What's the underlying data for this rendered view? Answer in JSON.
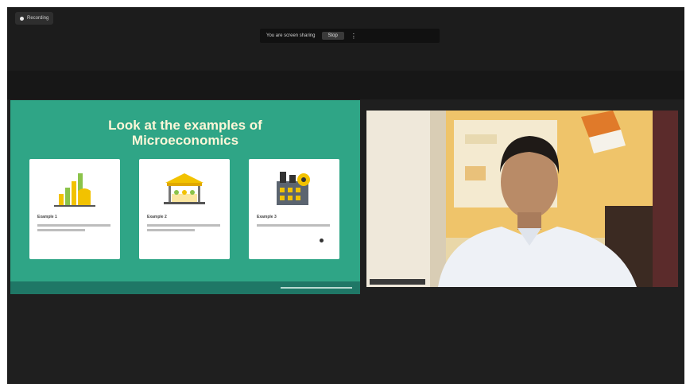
{
  "topbar": {
    "recording_tag": "Recording",
    "share_text": "You are screen sharing",
    "stop_label": "Stop",
    "more_label": "⋮"
  },
  "slide": {
    "title_line1": "Look at the examples of",
    "title_line2": "Microeconomics",
    "cards": [
      {
        "title": "Example 1",
        "icon": "growth-chart-icon"
      },
      {
        "title": "Example 2",
        "icon": "market-stall-icon"
      },
      {
        "title": "Example 3",
        "icon": "factory-icon"
      }
    ]
  },
  "colors": {
    "slide_bg": "#2fa586",
    "slide_title": "#fdf6d8",
    "app_bg": "#1f1f1f"
  }
}
